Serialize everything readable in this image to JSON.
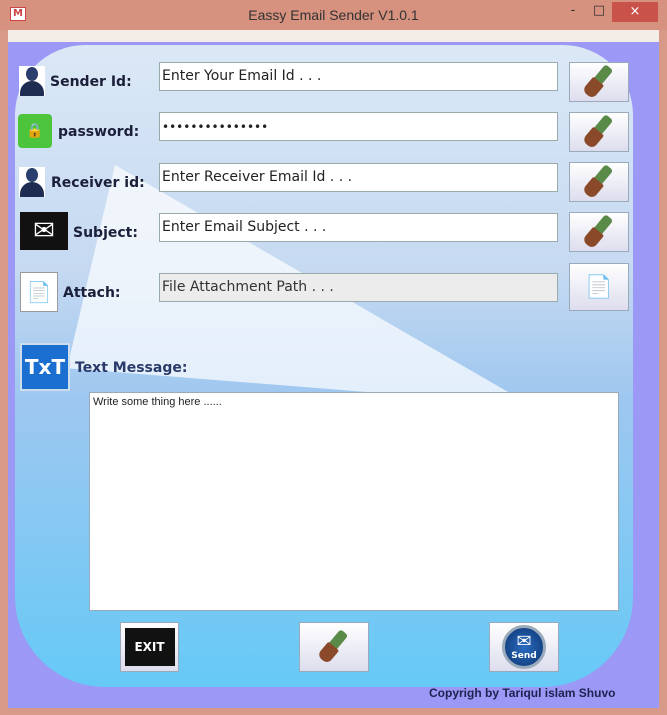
{
  "window": {
    "title": "Eassy Email Sender  V1.0.1",
    "app_icon": "gmail-icon",
    "minimize": "-",
    "maximize": "□",
    "close": "×"
  },
  "form": {
    "sender": {
      "label": "Sender Id:",
      "value": "Enter Your Email Id . . .",
      "icon": "person-icon"
    },
    "password": {
      "label": "password:",
      "value": "•••••••••••••••",
      "icon": "lock-icon"
    },
    "receiver": {
      "label": "Receiver id:",
      "value": "Enter Receiver Email Id . . .",
      "icon": "person-icon"
    },
    "subject": {
      "label": "Subject:",
      "value": "Enter Email Subject . . .",
      "icon": "envelope-icon"
    },
    "attach": {
      "label": "Attach:",
      "value": "File Attachment Path . . .",
      "icon": "document-icon"
    },
    "message": {
      "label": "Text Message:",
      "value": "Write some thing here ......",
      "icon_text": "TxT"
    }
  },
  "buttons": {
    "exit_text": "EXIT",
    "send_text": "Send"
  },
  "footer": {
    "copyright": "Copyrigh by Tariqul islam Shuvo"
  }
}
